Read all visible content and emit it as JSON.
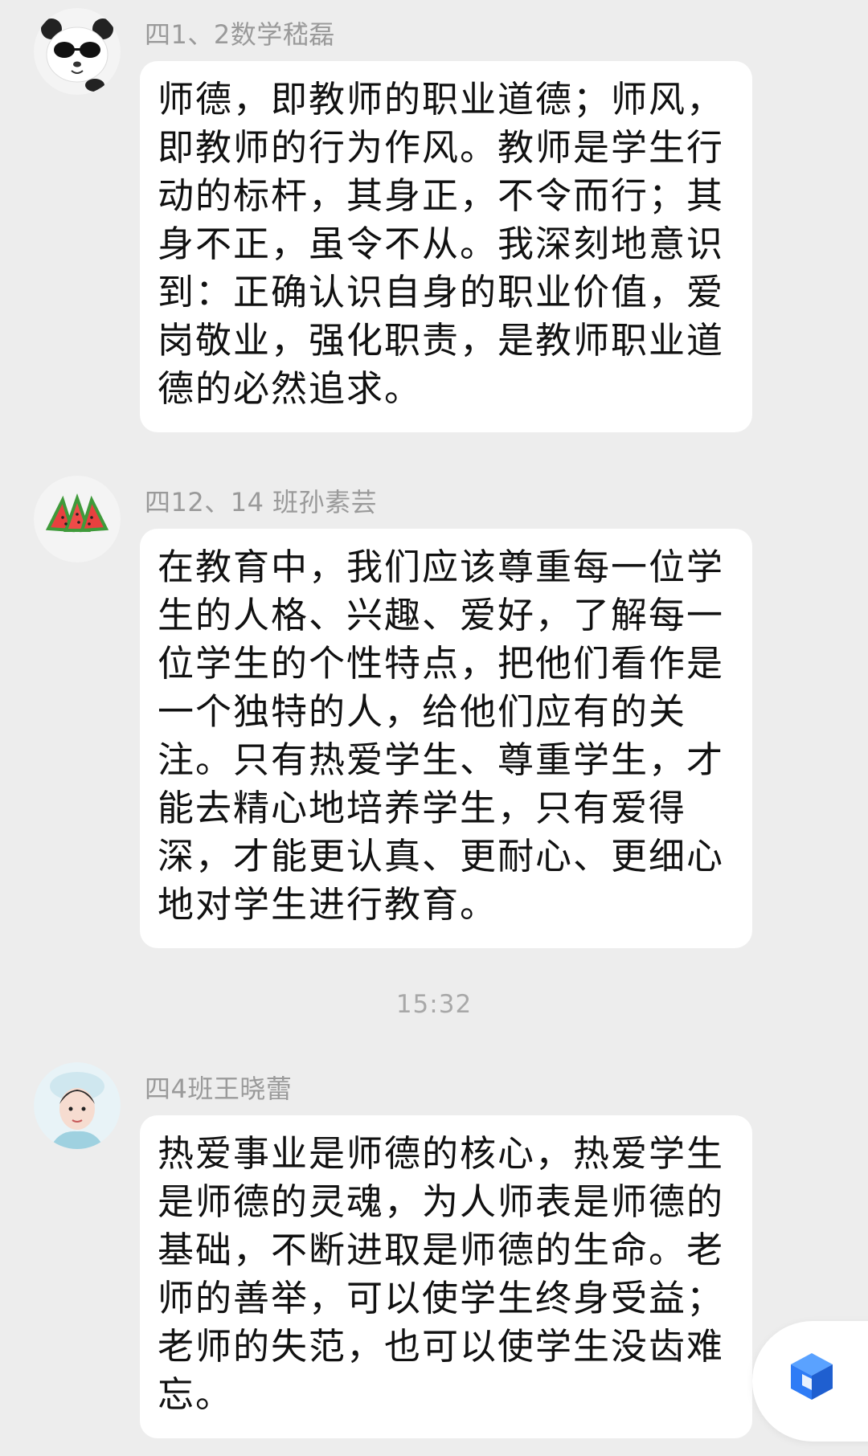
{
  "messages": [
    {
      "sender": "四1、2数学嵇磊",
      "avatar_icon": "panda-avatar-icon",
      "text": "师德，即教师的职业道德；师风，即教师的行为作风。教师是学生行动的标杆，其身正，不令而行；其身不正，虽令不从。我深刻地意识到：正确认识自身的职业价值，爱岗敬业，强化职责，是教师职业道德的必然追求。"
    },
    {
      "sender": "四12、14 班孙素芸",
      "avatar_icon": "watermelon-avatar-icon",
      "text": "在教育中，我们应该尊重每一位学生的人格、兴趣、爱好，了解每一位学生的个性特点，把他们看作是一个独特的人，给他们应有的关注。只有热爱学生、尊重学生，才能去精心地培养学生，只有爱得深，才能更认真、更耐心、更细心地对学生进行教育。"
    },
    {
      "sender": "四4班王晓蕾",
      "avatar_icon": "girl-photo-avatar-icon",
      "text": "热爱事业是师德的核心，热爱学生是师德的灵魂，为人师表是师德的基础，不断进取是师德的生命。老师的善举，可以使学生终身受益；老师的失范，也可以使学生没齿难忘。"
    }
  ],
  "timestamp": "15:32",
  "floating_button": {
    "icon": "cube-logo-icon",
    "color": "#2f7cf6"
  },
  "colors": {
    "background": "#ededed",
    "bubble": "#ffffff",
    "sender_text": "#9a9a9a",
    "body_text": "#111111"
  }
}
